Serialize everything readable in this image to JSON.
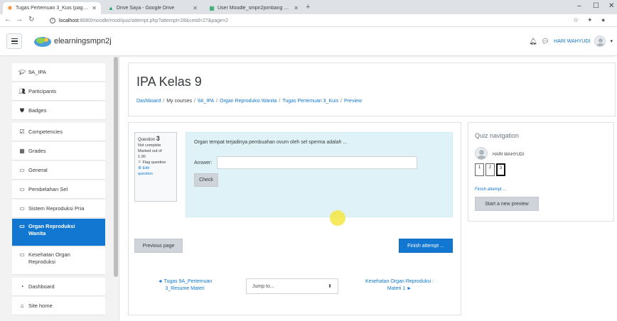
{
  "browser": {
    "tabs": [
      {
        "label": "Tugas Pertemuan 3_Kuis (page 2 ..."
      },
      {
        "label": "Drive Saya - Google Drive"
      },
      {
        "label": "User Moodle_smpn2jombang - ..."
      }
    ],
    "new_tab": "+",
    "url_host": "localhost",
    "url_rest": ":8080/moodle/mod/quiz/attempt.php?attempt=28&cmid=27&page=2",
    "window": {
      "minimize": "–",
      "maximize": "☐",
      "close": "✕"
    }
  },
  "navbar": {
    "site_name": "elearningsmpn2j",
    "user_name": "HARI WAHYUDI",
    "colors": {
      "brand": "#1177d1"
    }
  },
  "drawer": {
    "items": [
      {
        "label": "9A_IPA",
        "icon": "graduation-cap-icon"
      },
      {
        "label": "Participants",
        "icon": "users-icon"
      },
      {
        "label": "Badges",
        "icon": "shield-icon"
      },
      {
        "label": "Competencies",
        "icon": "checkbox-icon"
      },
      {
        "label": "Grades",
        "icon": "table-icon"
      },
      {
        "label": "General",
        "icon": "folder-icon"
      },
      {
        "label": "Pembelahan Sel",
        "icon": "folder-icon"
      },
      {
        "label": "Sistem Reproduksi Pria",
        "icon": "folder-icon"
      },
      {
        "label_1": "Organ Reproduksi",
        "label_2": "Wanita",
        "icon": "folder-icon"
      },
      {
        "label_1": "Kesehatan Organ",
        "label_2": "Reproduksi",
        "icon": "folder-icon"
      },
      {
        "label": "Dashboard",
        "icon": "dashboard-icon"
      },
      {
        "label": "Site home",
        "icon": "home-icon"
      }
    ]
  },
  "header": {
    "title": "IPA Kelas 9",
    "breadcrumb": [
      "Dashboard",
      "My courses",
      "9A_IPA",
      "Organ Reproduksi Wanita",
      "Tugas Pertemuan 3_Kuis",
      "Preview"
    ]
  },
  "question": {
    "label": "Question",
    "number": "3",
    "status": "Not complete",
    "marked": "Marked out of",
    "mark_value": "1.00",
    "flag": "Flag question",
    "edit_1": "Edit",
    "edit_2": "question",
    "text": "Organ tempat terjadinya pembuahan ovum oleh sel sperma adalah ...",
    "answer_label": "Answer:",
    "answer_value": "",
    "check_label": "Check"
  },
  "actions": {
    "previous": "Previous page",
    "finish": "Finish attempt ..."
  },
  "activity_nav": {
    "prev_1": "◄ Tugas 9A_Pertemuan",
    "prev_2": "3_Resume Materi",
    "jump": "Jump to...",
    "next_1": "Kesehatan Organ Reproduksi :",
    "next_2": "Materi 1 ►"
  },
  "quiz_nav": {
    "title": "Quiz navigation",
    "user": "HARI WAHYUDI",
    "buttons": [
      "1",
      "2",
      "3"
    ],
    "finish": "Finish attempt ...",
    "new_preview": "Start a new preview"
  }
}
